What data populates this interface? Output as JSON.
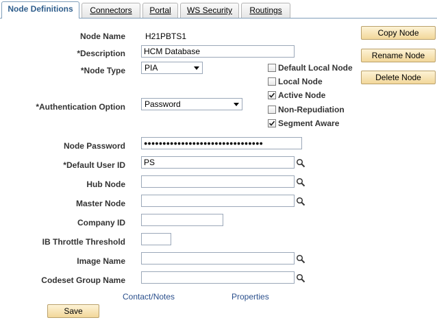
{
  "tabs": [
    {
      "label": "Node Definitions",
      "active": true
    },
    {
      "label": "Connectors",
      "active": false
    },
    {
      "label": "Portal",
      "active": false
    },
    {
      "label": "WS Security",
      "active": false
    },
    {
      "label": "Routings",
      "active": false
    }
  ],
  "form": {
    "node_name_label": "Node Name",
    "node_name_value": "H21PBTS1",
    "description_label": "*Description",
    "description_value": "HCM Database",
    "node_type_label": "*Node Type",
    "node_type_value": "PIA",
    "auth_option_label": "*Authentication Option",
    "auth_option_value": "Password",
    "node_password_label": "Node Password",
    "node_password_value": "●●●●●●●●●●●●●●●●●●●●●●●●●●●●●●●●",
    "default_user_label": "*Default User ID",
    "default_user_value": "PS",
    "hub_node_label": "Hub Node",
    "hub_node_value": "",
    "master_node_label": "Master Node",
    "master_node_value": "",
    "company_id_label": "Company ID",
    "company_id_value": "",
    "ib_throttle_label": "IB Throttle Threshold",
    "ib_throttle_value": "",
    "image_name_label": "Image Name",
    "image_name_value": "",
    "codeset_label": "Codeset Group Name",
    "codeset_value": ""
  },
  "checkboxes": [
    {
      "label": "Default Local Node",
      "checked": false
    },
    {
      "label": "Local Node",
      "checked": false
    },
    {
      "label": "Active Node",
      "checked": true
    },
    {
      "label": "Non-Repudiation",
      "checked": false
    },
    {
      "label": "Segment Aware",
      "checked": true
    }
  ],
  "buttons": {
    "copy": "Copy Node",
    "rename": "Rename Node",
    "delete": "Delete Node",
    "save": "Save"
  },
  "links": {
    "contact": "Contact/Notes",
    "properties": "Properties"
  },
  "colors": {
    "active_tab_text": "#2f5e8c",
    "link": "#2a4f8c",
    "button_bg": "#f2d79a"
  }
}
